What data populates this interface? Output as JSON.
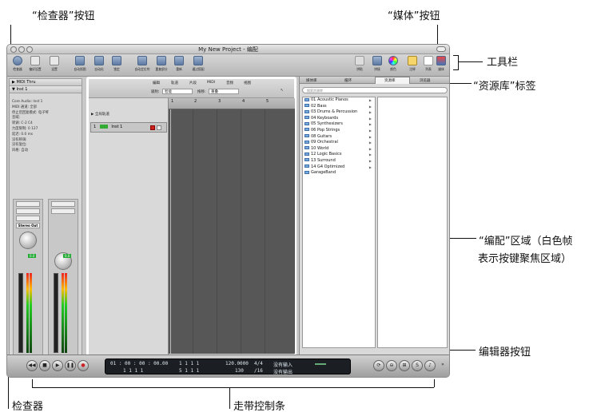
{
  "callouts": {
    "inspector_button": "“检查器”按钮",
    "media_button": "“媒体”按钮",
    "toolbar": "工具栏",
    "library_tab": "“资源库”标签",
    "arrange_area_line1": "“编配”区域（白色帧",
    "arrange_area_line2": "表示按键聚焦区域）",
    "editor_buttons": "编辑器按钮",
    "inspector": "检查器",
    "transport_bar": "走带控制条"
  },
  "window": {
    "title": "My New Project - 编配"
  },
  "toolbar": {
    "left": [
      "检查器",
      "偏好设置",
      "设置",
      "自动视图",
      "自动化",
      "锁定",
      "自动定位符",
      "重复部分",
      "重新",
      "通过搭配"
    ],
    "right": [
      "拼贴",
      "拼接",
      "颜色",
      "注释",
      "列表",
      "媒体"
    ]
  },
  "inspector_panel": {
    "region_header": "MIDI Thru",
    "track_header": "Inst 1",
    "params": [
      "Core Audio: Inst 1",
      "MIDI 通道: 全部",
      "停止后回复模式: 电子琴",
      "音域:",
      "转调: C-2 C4",
      "力度限制: 0 127",
      "延迟: 0.0 ms",
      "没有移调:",
      "没有复位:",
      "风格: 自动"
    ],
    "strip_output": "Stereo Out",
    "strip_label_1": "Inst 1",
    "strip_label_2": "Stereo Out",
    "volume_1": "0.0",
    "volume_2": "0.0"
  },
  "arrange": {
    "menus": [
      "编辑",
      "轨道",
      "片段",
      "MIDI",
      "音频",
      "视图"
    ],
    "snap_label": "吸附:",
    "snap_value": "智能",
    "drag_label": "拖移:",
    "drag_value": "重叠",
    "global_tracks": "全局轨道",
    "track_number": "1",
    "track_name": "Inst 1",
    "ruler": [
      "1",
      "2",
      "3",
      "4",
      "5"
    ]
  },
  "editor_buttons": [
    "调音台",
    "样本编辑器",
    "钢琴卷帘窗",
    "乐谱",
    "Hyper Editor"
  ],
  "media_panel": {
    "tabs": [
      "媒体库",
      "循环",
      "资源库",
      "浏览器"
    ],
    "search_placeholder": "搜索资源库",
    "folders": [
      "01 Acoustic Pianos",
      "02 Bass",
      "03 Drums & Percussion",
      "04 Keyboards",
      "05 Synthesizers",
      "06 Pop Strings",
      "08 Guitars",
      "09 Orchestral",
      "10 World",
      "12 Logic Basics",
      "13 Surround",
      "14 G4 Optimized",
      "GarageBand"
    ]
  },
  "transport": {
    "smpte": "01 : 00 : 00 : 00.00",
    "bars_top": "1   1   1   1",
    "bars_bottom": "1   1   1   1",
    "locator_top": "1   1   1   1",
    "locator_bottom": "5   1   1   1",
    "tempo": "120.0000",
    "tempo_div": "130",
    "signature": "4/4",
    "division": "/16",
    "in_label": "没有输入",
    "out_label": "没有输出"
  }
}
